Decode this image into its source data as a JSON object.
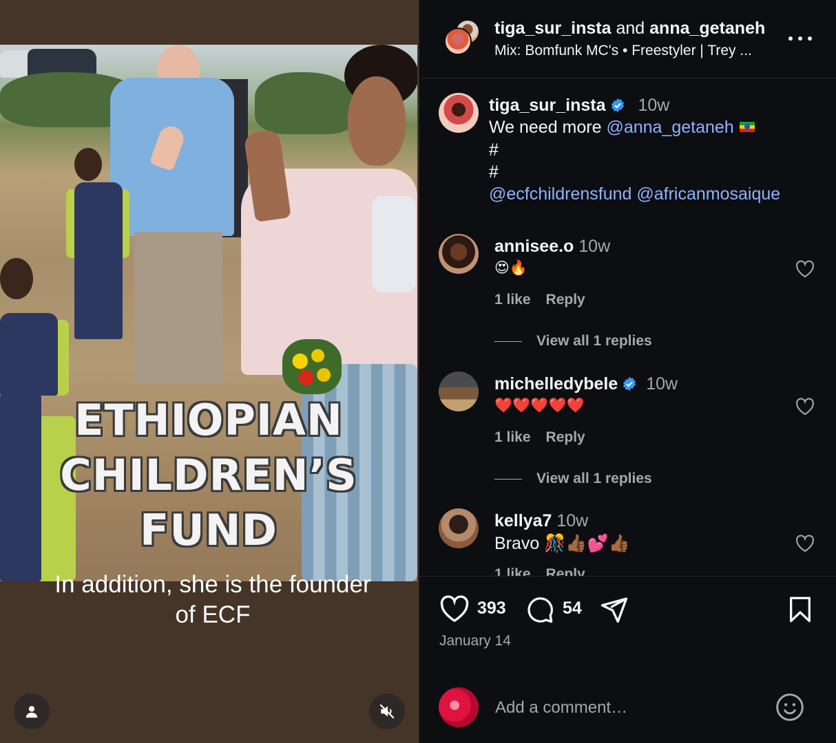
{
  "post": {
    "overlay_lines": [
      "ETHIOPIAN",
      "CHILDREN’S",
      "FUND"
    ],
    "caption_lines": [
      "In addition, she is the founder",
      "of ECF"
    ]
  },
  "header": {
    "user1": "tiga_sur_insta",
    "and_text": "and",
    "user2": "anna_getaneh",
    "audio": "Mix: Bomfunk MC's • Freestyler | Trey ..."
  },
  "caption_comment": {
    "username": "tiga_sur_insta",
    "time": "10w",
    "text": "We need more",
    "mention": "@anna_getaneh",
    "hash1": "#",
    "hash2": "#",
    "mentions_line": "@ecfchildrensfund @africanmosaique"
  },
  "comments": [
    {
      "username": "annisee.o",
      "time": "10w",
      "text": "😍🔥",
      "likes": "1 like",
      "reply": "Reply",
      "view_replies": "View all 1 replies"
    },
    {
      "username": "michelledybele",
      "time": "10w",
      "text": "❤️❤️❤️❤️❤️",
      "likes": "1 like",
      "reply": "Reply",
      "view_replies": "View all 1 replies"
    },
    {
      "username": "kellya7",
      "time": "10w",
      "text": "Bravo 🎊👍🏾💕👍🏾",
      "likes": "1 like",
      "reply": "Reply"
    }
  ],
  "actions": {
    "likes_count": "393",
    "comments_count": "54",
    "date": "January 14"
  },
  "add_comment": {
    "placeholder": "Add a comment…"
  },
  "colors": {
    "panel_bg": "#0c0e11",
    "media_bg": "#453428",
    "mention": "#8fb3ff",
    "verified": "#3797f0",
    "muted_text": "#a8a8a8"
  },
  "icons": [
    "user-tag-icon",
    "mute-icon",
    "more-icon",
    "verified-icon",
    "heart-icon",
    "comment-icon",
    "share-icon",
    "bookmark-icon",
    "emoji-icon"
  ]
}
